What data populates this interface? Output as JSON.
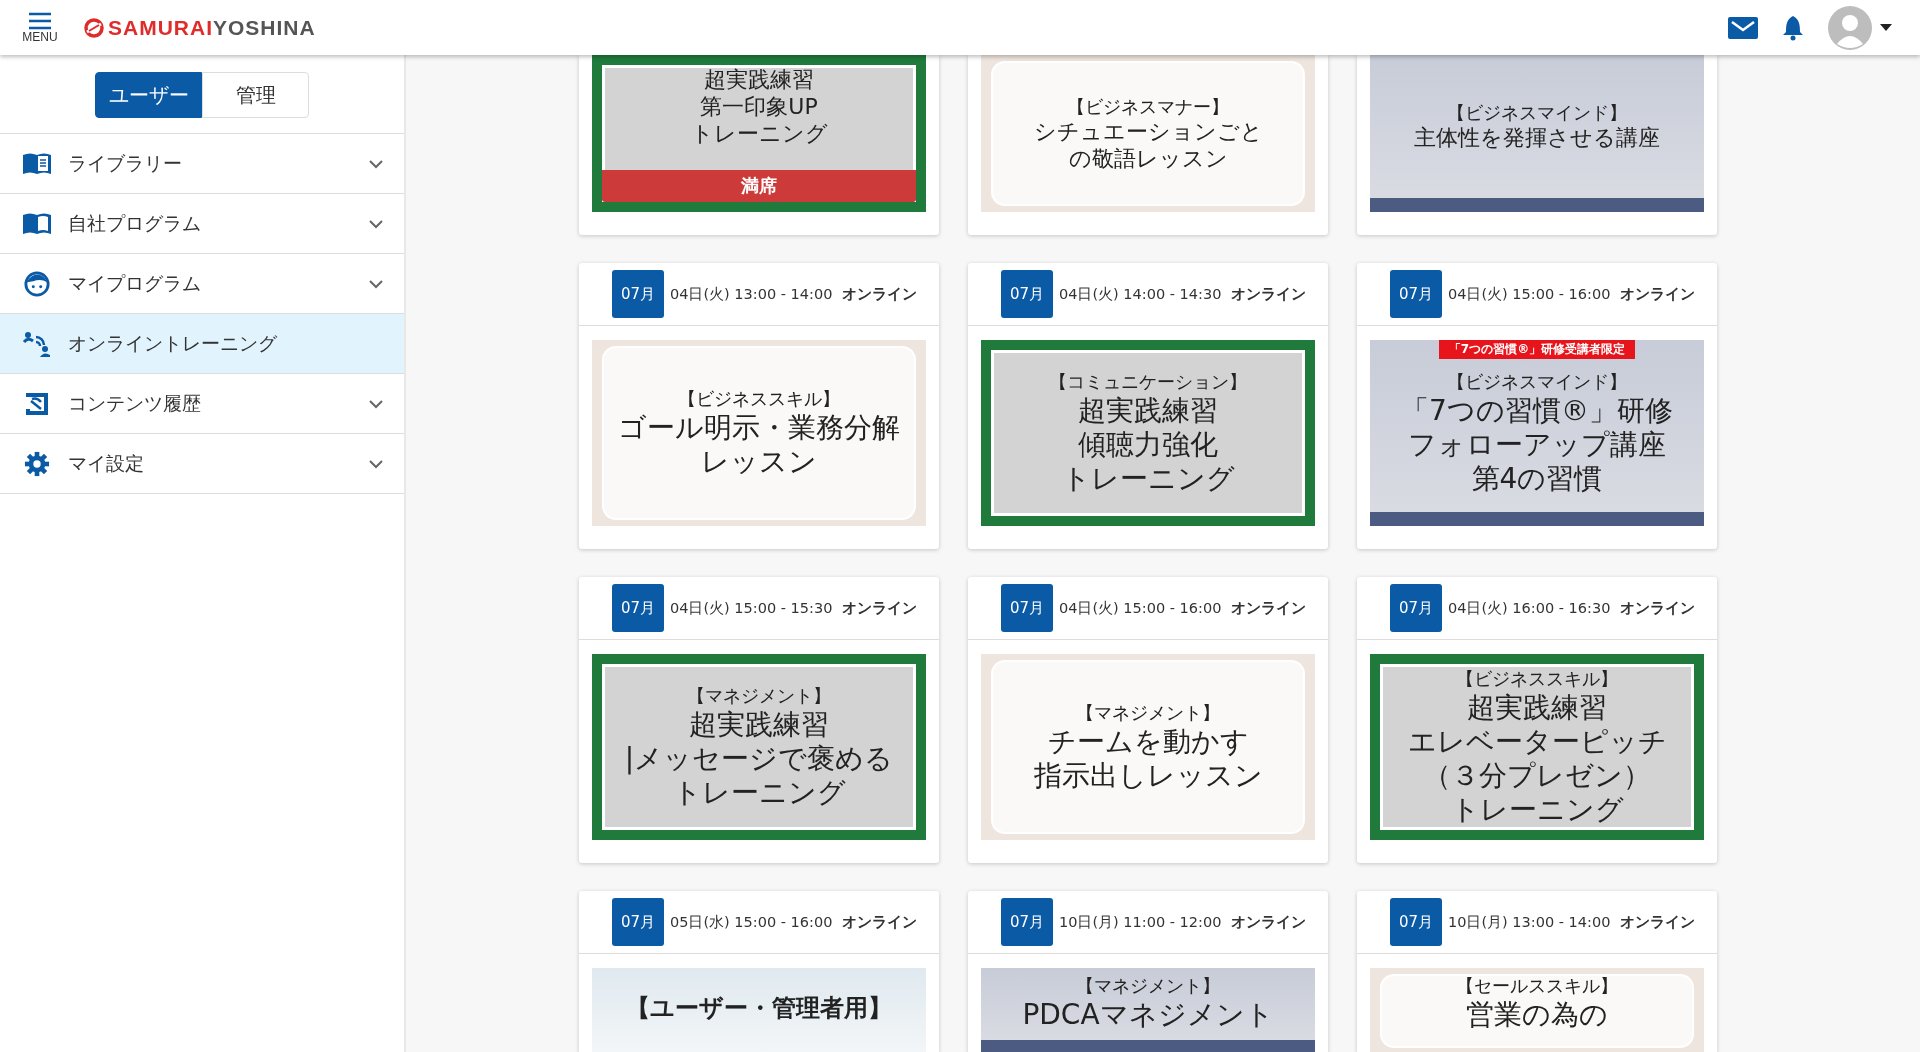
{
  "header": {
    "menu_label": "MENU",
    "logo_parts": [
      "SAMURAI",
      "YOSHINA"
    ]
  },
  "sidebar": {
    "mode_tabs": [
      {
        "label": "ユーザー",
        "selected": true
      },
      {
        "label": "管理",
        "selected": false
      }
    ],
    "items": [
      {
        "label": "ライブラリー",
        "kind": "library",
        "expandable": true,
        "selected": false
      },
      {
        "label": "自社プログラム",
        "kind": "book",
        "expandable": true,
        "selected": false
      },
      {
        "label": "マイプログラム",
        "kind": "face",
        "expandable": true,
        "selected": false
      },
      {
        "label": "オンライントレーニング",
        "kind": "online",
        "expandable": false,
        "selected": true
      },
      {
        "label": "コンテンツ履歴",
        "kind": "history",
        "expandable": true,
        "selected": false
      },
      {
        "label": "マイ設定",
        "kind": "gear",
        "expandable": true,
        "selected": false
      }
    ]
  },
  "rows": [
    {
      "cards": [
        {
          "thumb": {
            "kind": "green",
            "title_lines": [
              "超実践練習",
              "第一印象UP",
              "トレーニング"
            ],
            "overlay": "満席"
          }
        },
        {
          "thumb": {
            "kind": "desk",
            "category": "【ビジネスマナー】",
            "title_lines": [
              "シチュエーションごと",
              "の敬語レッスン"
            ]
          }
        },
        {
          "thumb": {
            "kind": "blue",
            "category": "【ビジネスマインド】",
            "title_lines": [
              "主体性を発揮させる講座"
            ]
          }
        }
      ]
    },
    {
      "cards": [
        {
          "month": "07月",
          "schedule": "04日(火) 13:00 - 14:00",
          "place": "オンライン",
          "thumb": {
            "kind": "desk",
            "category": "【ビジネススキル】",
            "title_lines": [
              "ゴール明示・業務分解",
              "レッスン"
            ]
          }
        },
        {
          "month": "07月",
          "schedule": "04日(火) 14:00 - 14:30",
          "place": "オンライン",
          "thumb": {
            "kind": "green",
            "category": "【コミュニケーション】",
            "title_lines": [
              "超実践練習",
              "傾聴力強化",
              "トレーニング"
            ]
          }
        },
        {
          "month": "07月",
          "schedule": "04日(火) 15:00 - 16:00",
          "place": "オンライン",
          "thumb": {
            "kind": "blue",
            "ribbon": "「7つの習慣®」研修受講者限定",
            "category": "【ビジネスマインド】",
            "title_lines": [
              "「7つの習慣®」研修",
              "フォローアップ講座",
              "第4の習慣"
            ]
          }
        }
      ]
    },
    {
      "cards": [
        {
          "month": "07月",
          "schedule": "04日(火) 15:00 - 15:30",
          "place": "オンライン",
          "thumb": {
            "kind": "green",
            "category": "【マネジメント】",
            "title_lines": [
              "超実践練習",
              "|メッセージで褒める",
              "トレーニング"
            ]
          }
        },
        {
          "month": "07月",
          "schedule": "04日(火) 15:00 - 16:00",
          "place": "オンライン",
          "thumb": {
            "kind": "desk",
            "category": "【マネジメント】",
            "title_lines": [
              "チームを動かす",
              "指示出しレッスン"
            ]
          }
        },
        {
          "month": "07月",
          "schedule": "04日(火) 16:00 - 16:30",
          "place": "オンライン",
          "thumb": {
            "kind": "green",
            "category": "【ビジネススキル】",
            "title_lines": [
              "超実践練習",
              "エレベーターピッチ",
              "（３分プレゼン）",
              "トレーニング"
            ]
          }
        }
      ]
    },
    {
      "cards": [
        {
          "month": "07月",
          "schedule": "05日(水) 15:00 - 16:00",
          "place": "オンライン",
          "thumb": {
            "kind": "office",
            "title_lines": [
              "【ユーザー・管理者用】"
            ]
          }
        },
        {
          "month": "07月",
          "schedule": "10日(月) 11:00 - 12:00",
          "place": "オンライン",
          "thumb": {
            "kind": "blue",
            "category": "【マネジメント】",
            "title_lines": [
              "PDCAマネジメント"
            ]
          }
        },
        {
          "month": "07月",
          "schedule": "10日(月) 13:00 - 14:00",
          "place": "オンライン",
          "thumb": {
            "kind": "desk",
            "category": "【セールススキル】",
            "title_lines": [
              "営業の為の"
            ]
          }
        }
      ]
    }
  ]
}
